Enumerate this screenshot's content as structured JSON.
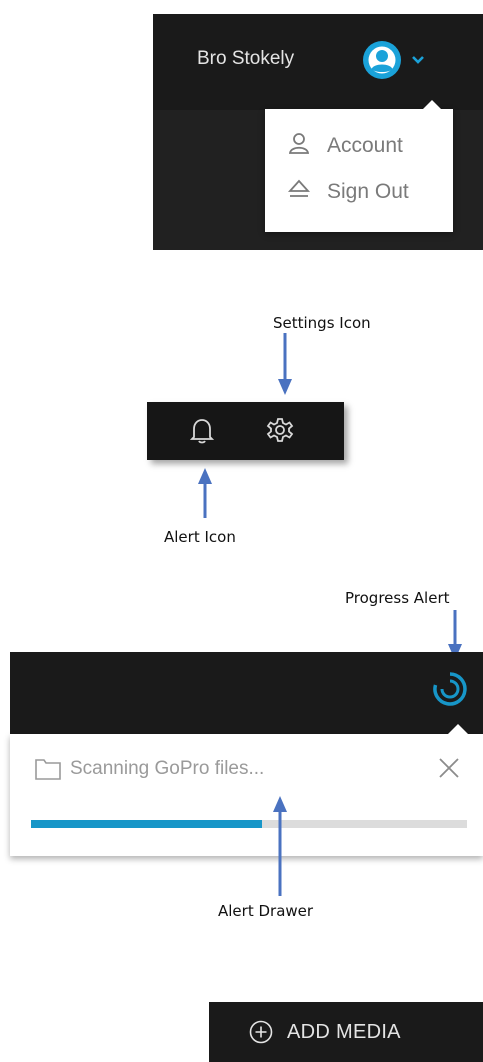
{
  "account_panel": {
    "user_name": "Bro Stokely",
    "avatar_icon": "user-avatar-icon",
    "menu_toggle_icon": "chevron-down-icon",
    "menu_items": [
      {
        "label": "Account",
        "icon": "user-icon"
      },
      {
        "label": "Sign Out",
        "icon": "eject-icon"
      }
    ]
  },
  "icon_toolbar": {
    "alert_icon": "bell-icon",
    "settings_icon": "gear-icon"
  },
  "annotations": {
    "settings_icon": "Settings Icon",
    "alert_icon": "Alert Icon",
    "progress_alert": "Progress Alert",
    "alert_drawer": "Alert Drawer"
  },
  "progress_alert": {
    "indicator_icon": "spinner-icon",
    "message": "Scanning GoPro files...",
    "folder_icon": "folder-icon",
    "close_icon": "close-icon",
    "progress_fraction": 0.53
  },
  "add_media": {
    "label": "ADD MEDIA",
    "icon": "plus-circle-icon"
  },
  "colors": {
    "dark_bar": "#1a1a1a",
    "accent_blue": "#1796c8",
    "avatar_blue": "#1aa2d9",
    "arrow_blue": "#4a72c0"
  }
}
